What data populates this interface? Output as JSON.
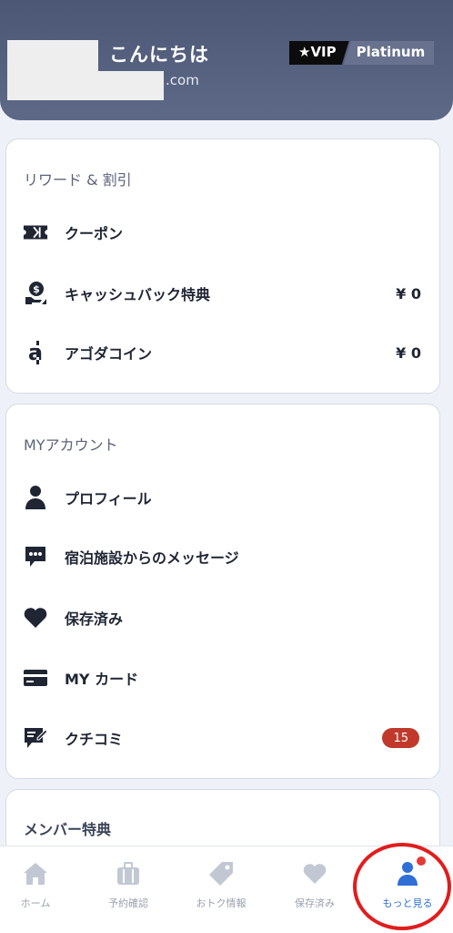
{
  "header": {
    "greeting": "こんにちは",
    "email_suffix": ".com",
    "vip_label": "★VIP",
    "tier": "Platinum"
  },
  "rewards": {
    "title": "リワード & 割引",
    "items": [
      {
        "icon": "ticket-icon",
        "label": "クーポン",
        "value": ""
      },
      {
        "icon": "cashback-hand-icon",
        "label": "キャッシュバック特典",
        "value": "¥ 0"
      },
      {
        "icon": "agoda-coin-icon",
        "label": "アゴダコイン",
        "value": "¥ 0"
      }
    ]
  },
  "account": {
    "title": "MYアカウント",
    "items": [
      {
        "icon": "person-icon",
        "label": "プロフィール"
      },
      {
        "icon": "message-icon",
        "label": "宿泊施設からのメッセージ"
      },
      {
        "icon": "heart-icon",
        "label": "保存済み"
      },
      {
        "icon": "credit-card-icon",
        "label": "MY カード"
      },
      {
        "icon": "review-icon",
        "label": "クチコミ",
        "badge": "15"
      }
    ]
  },
  "member": {
    "title": "メンバー特典"
  },
  "bottom_nav": {
    "items": [
      {
        "icon": "home-icon",
        "label": "ホーム"
      },
      {
        "icon": "suitcase-icon",
        "label": "予約確認"
      },
      {
        "icon": "tag-icon",
        "label": "おトク情報"
      },
      {
        "icon": "heart-icon",
        "label": "保存済み"
      },
      {
        "icon": "person-icon",
        "label": "もっと見る"
      }
    ],
    "active_index": 4
  },
  "colors": {
    "header": "#55617f",
    "accent": "#2f6fd6",
    "badge": "#c0392b",
    "highlight": "#e11d1d"
  }
}
